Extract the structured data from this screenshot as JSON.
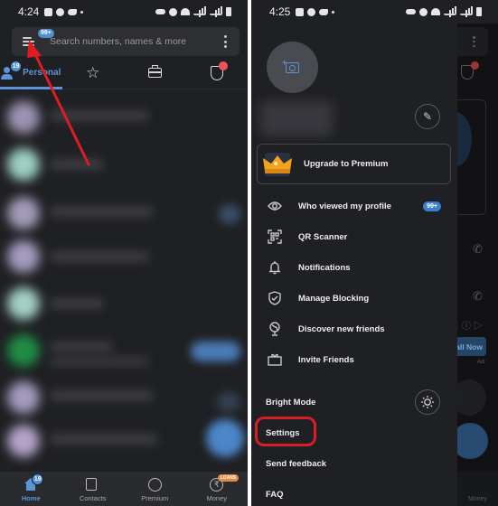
{
  "left_screen": {
    "status_bar": {
      "time": "4:24"
    },
    "search": {
      "placeholder": "Search numbers, names & more",
      "menu_badge": "99+"
    },
    "tabs": [
      {
        "label": "Personal",
        "badge": "19",
        "icon": "people-icon",
        "active": true
      },
      {
        "label": "",
        "icon": "star-icon"
      },
      {
        "label": "",
        "icon": "briefcase-icon"
      },
      {
        "label": "",
        "icon": "shield-block-icon",
        "has_red_dot": true
      }
    ],
    "bottom_nav": [
      {
        "label": "Home",
        "badge": "19",
        "icon": "home-icon",
        "active": true
      },
      {
        "label": "Contacts",
        "icon": "contacts-icon"
      },
      {
        "label": "Premium",
        "icon": "crown-icon"
      },
      {
        "label": "Money",
        "icon": "rupee-icon",
        "badge": "LOANS"
      }
    ],
    "annotation": "red-arrow pointing to hamburger menu"
  },
  "right_screen": {
    "status_bar": {
      "time": "4:25"
    },
    "drawer": {
      "premium_label": "Upgrade to Premium",
      "menu_items": [
        {
          "label": "Who viewed my profile",
          "icon": "eye-icon",
          "badge": "99+"
        },
        {
          "label": "QR Scanner",
          "icon": "qr-scanner-icon"
        },
        {
          "label": "Notifications",
          "icon": "bell-icon"
        },
        {
          "label": "Manage Blocking",
          "icon": "shield-check-icon"
        },
        {
          "label": "Discover new friends",
          "icon": "globe-icon"
        },
        {
          "label": "Invite Friends",
          "icon": "gift-icon"
        }
      ],
      "bright_mode_label": "Bright Mode",
      "settings_label": "Settings",
      "feedback_label": "Send feedback",
      "faq_label": "FAQ"
    },
    "background": {
      "install_label": "tall Now",
      "ad_label": "Ad",
      "money_label": "Money"
    },
    "annotation": "red rounded rectangle highlighting Settings"
  },
  "colors": {
    "accent": "#5b93d4",
    "background": "#1f2023",
    "annotation_red": "#d61f26",
    "notification_red": "#f05555",
    "loans_orange": "#e58a3f"
  }
}
